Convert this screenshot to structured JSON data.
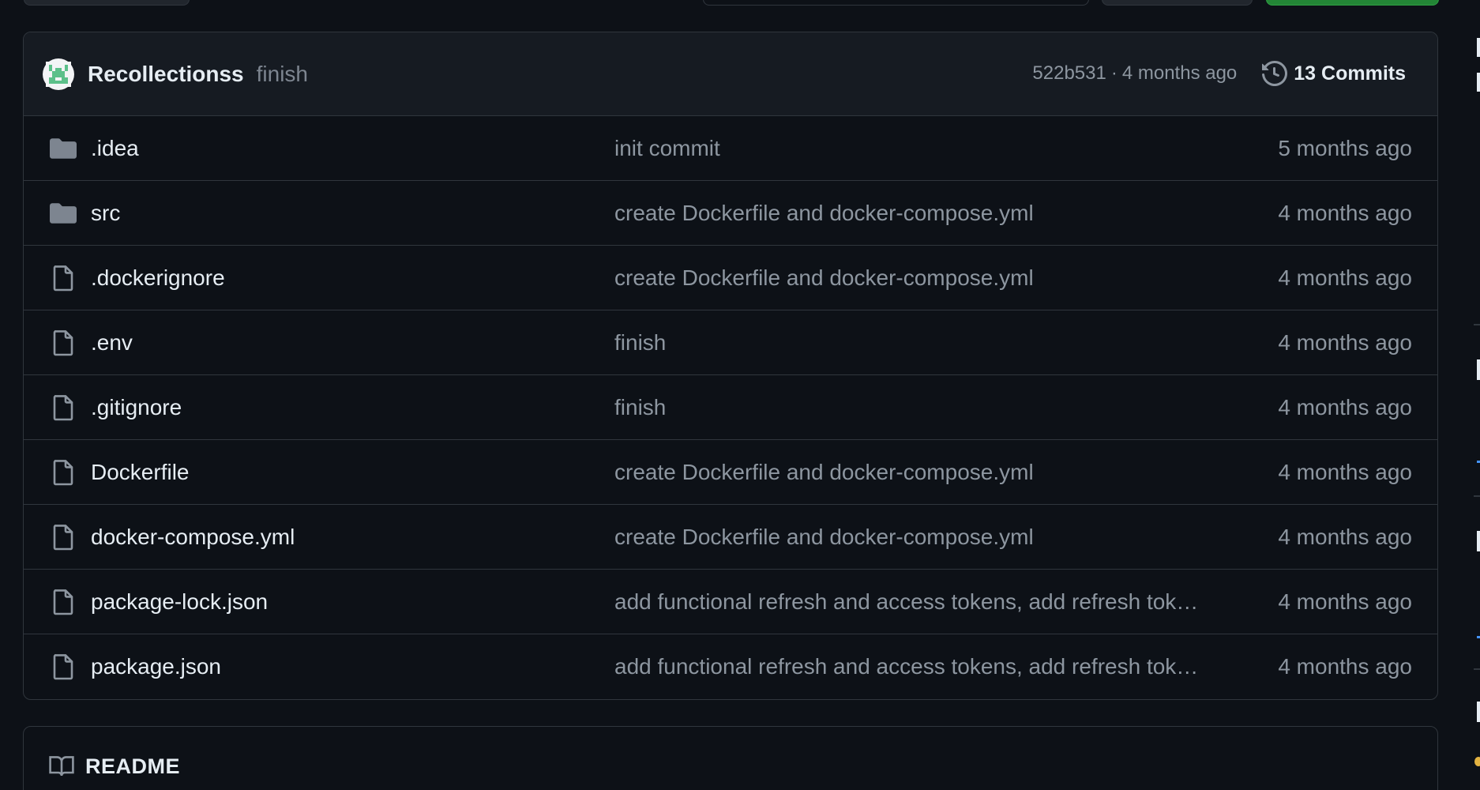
{
  "latest_commit": {
    "author": "Recollectionss",
    "message": "finish",
    "sha": "522b531",
    "separator": "·",
    "age": "4 months ago",
    "commit_count": "13 Commits"
  },
  "files": [
    {
      "type": "folder",
      "name": ".idea",
      "message": "init commit",
      "age": "5 months ago"
    },
    {
      "type": "folder",
      "name": "src",
      "message": "create Dockerfile and docker-compose.yml",
      "age": "4 months ago"
    },
    {
      "type": "file",
      "name": ".dockerignore",
      "message": "create Dockerfile and docker-compose.yml",
      "age": "4 months ago"
    },
    {
      "type": "file",
      "name": ".env",
      "message": "finish",
      "age": "4 months ago"
    },
    {
      "type": "file",
      "name": ".gitignore",
      "message": "finish",
      "age": "4 months ago"
    },
    {
      "type": "file",
      "name": "Dockerfile",
      "message": "create Dockerfile and docker-compose.yml",
      "age": "4 months ago"
    },
    {
      "type": "file",
      "name": "docker-compose.yml",
      "message": "create Dockerfile and docker-compose.yml",
      "age": "4 months ago"
    },
    {
      "type": "file",
      "name": "package-lock.json",
      "message": "add functional refresh and access tokens, add refresh tok…",
      "age": "4 months ago"
    },
    {
      "type": "file",
      "name": "package.json",
      "message": "add functional refresh and access tokens, add refresh tok…",
      "age": "4 months ago"
    }
  ],
  "readme": {
    "title": "README"
  },
  "colors": {
    "background": "#0d1117",
    "header_bg": "#161b22",
    "border": "#30363d",
    "muted_text": "#8d96a0",
    "primary_text": "#e6edf3",
    "folder_icon": "#7d8590",
    "accent_green": "#238636"
  },
  "icons": {
    "folder": "folder-icon",
    "file": "file-icon",
    "history": "history-icon",
    "readme": "book-icon"
  }
}
